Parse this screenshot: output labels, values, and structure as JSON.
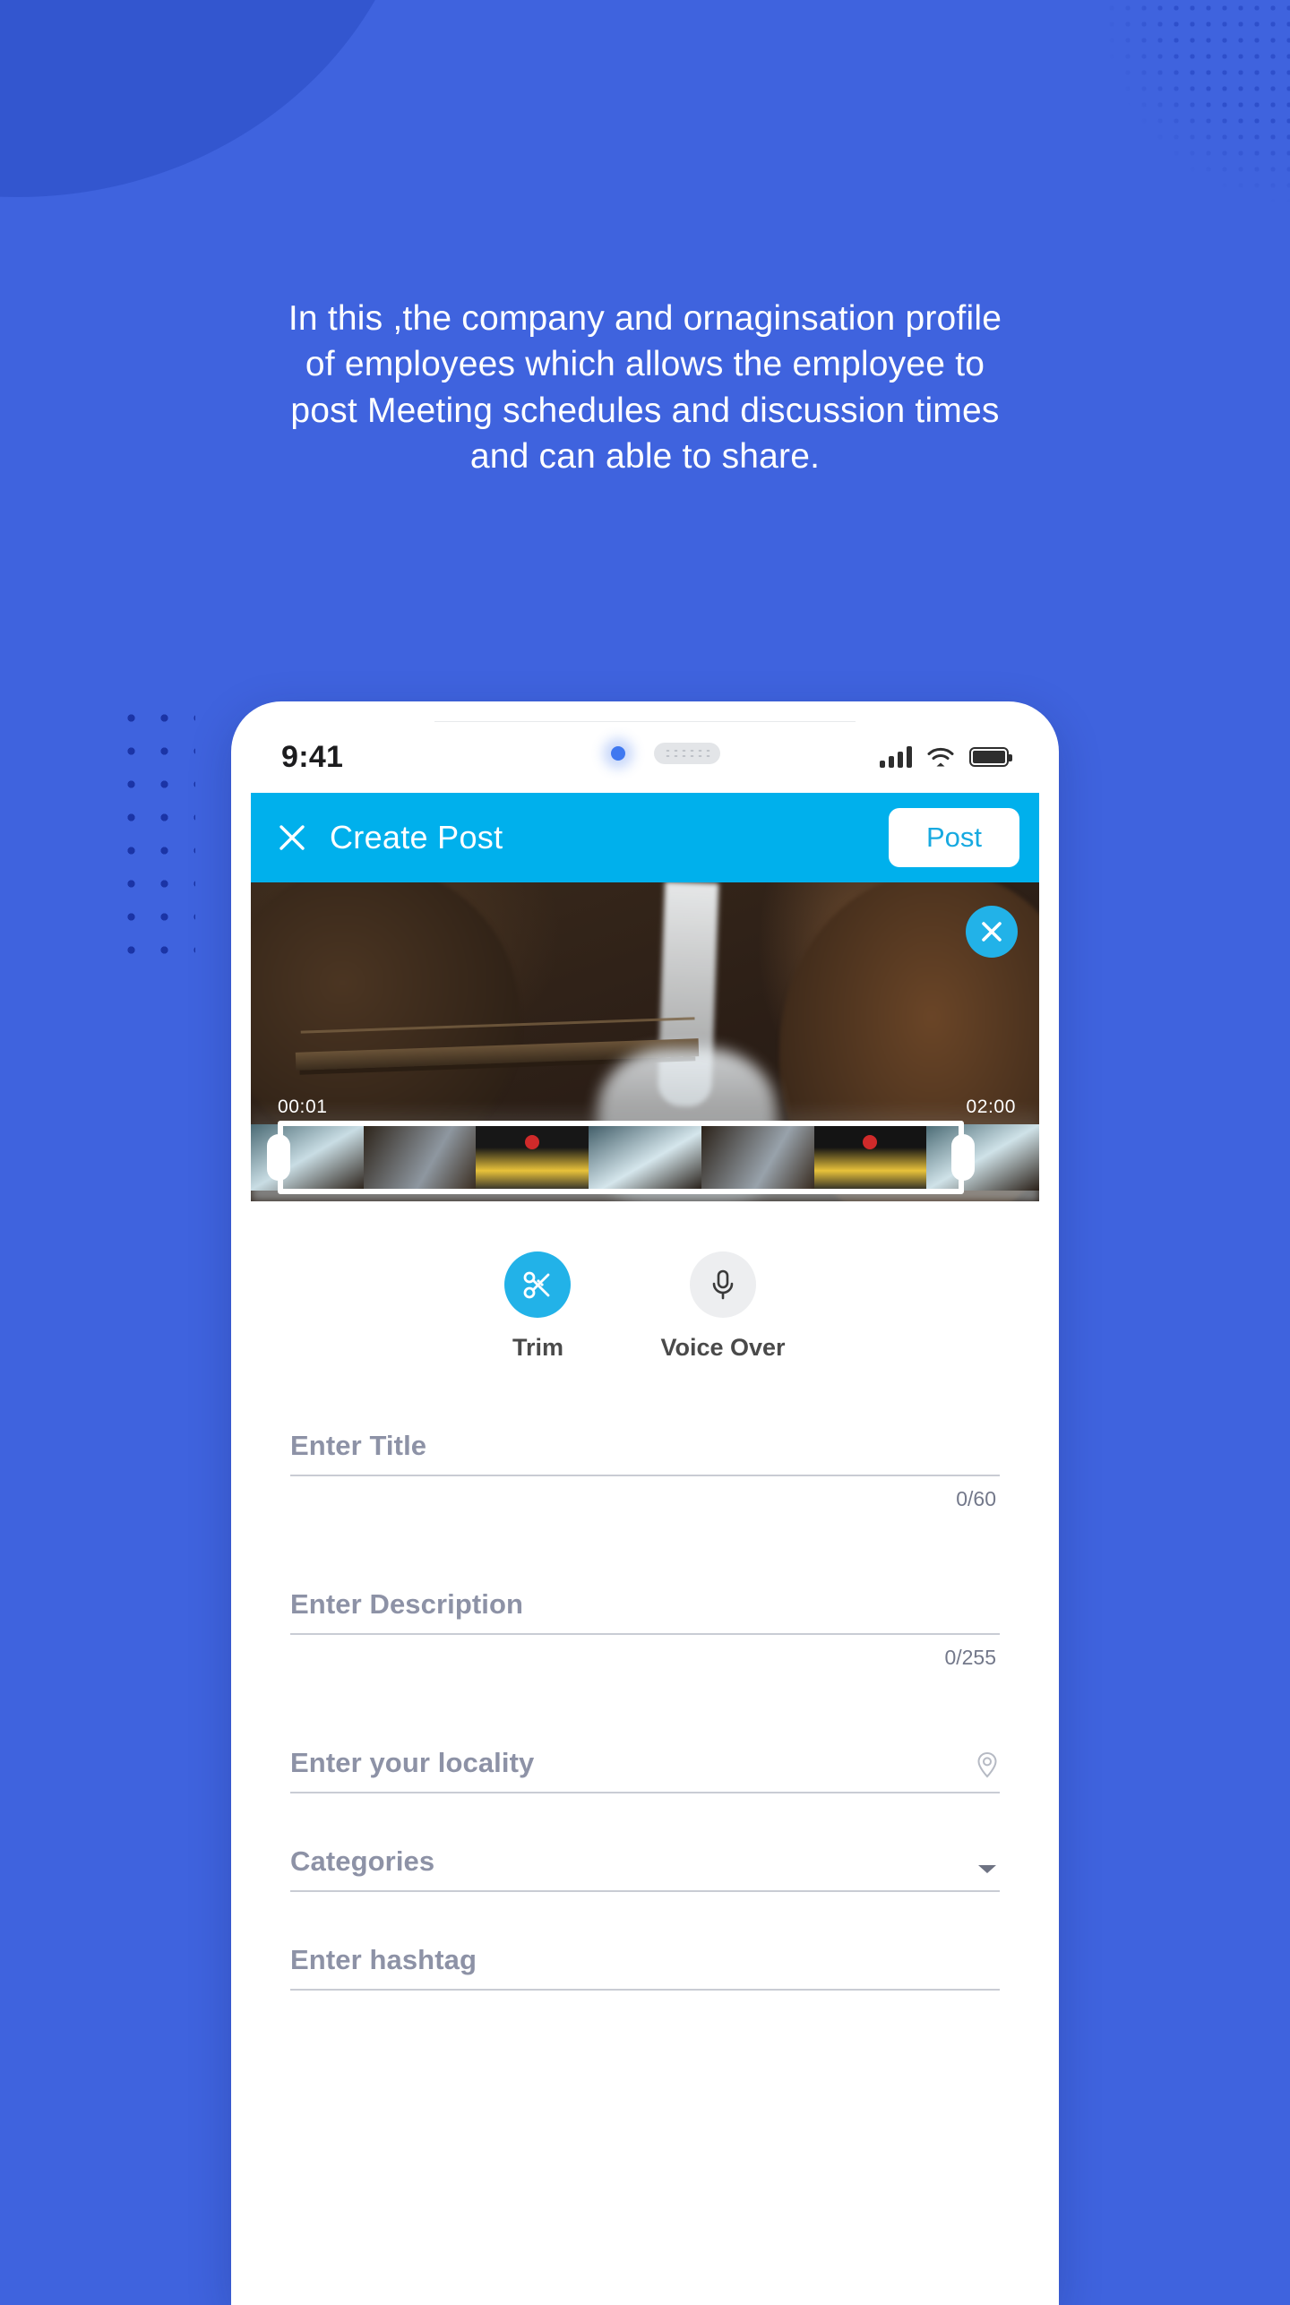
{
  "caption": {
    "text": "In this ,the company and ornaginsation profile of employees which allows the employee to post Meeting schedules and discussion times and can able to share."
  },
  "colors": {
    "page_background": "#3F63DE",
    "accent_cyan": "#00B0EC",
    "accent_cyan_button": "#22B2E8",
    "dot_pattern": "#1B34A6",
    "field_label": "#8D92A6",
    "field_underline": "#C9CCD4"
  },
  "phone": {
    "status_bar": {
      "time": "9:41",
      "icons": [
        "signal-icon",
        "wifi-icon",
        "battery-icon"
      ]
    },
    "app_bar": {
      "close_icon": "close-icon",
      "title": "Create Post",
      "post_label": "Post"
    },
    "video": {
      "close_icon": "close-circle-icon",
      "timeline": {
        "start_time": "00:01",
        "end_time": "02:00"
      }
    },
    "tools": [
      {
        "icon": "scissors-icon",
        "label": "Trim",
        "state": "active"
      },
      {
        "icon": "microphone-icon",
        "label": "Voice Over",
        "state": "idle"
      }
    ],
    "form": {
      "title": {
        "label": "Enter Title",
        "value": "",
        "counter": "0/60"
      },
      "description": {
        "label": "Enter Description",
        "value": "",
        "counter": "0/255"
      },
      "locality": {
        "label": "Enter your locality",
        "value": "",
        "icon": "location-pin-icon"
      },
      "categories": {
        "label": "Categories",
        "value": "",
        "icon": "chevron-down-icon"
      },
      "hashtag": {
        "label": "Enter hashtag",
        "value": ""
      }
    }
  }
}
